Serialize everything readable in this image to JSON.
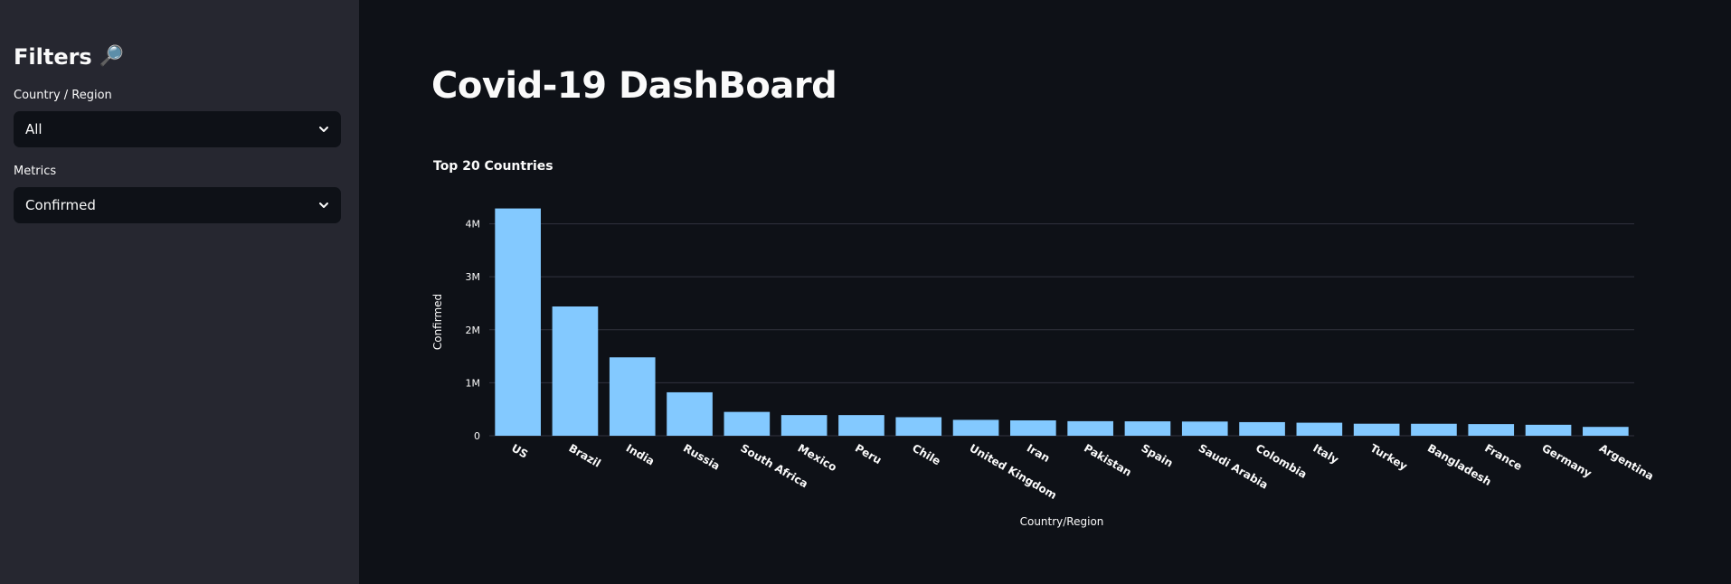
{
  "sidebar": {
    "title": "Filters",
    "title_icon": "🔎",
    "country_label": "Country / Region",
    "country_value": "All",
    "metrics_label": "Metrics",
    "metrics_value": "Confirmed"
  },
  "main": {
    "title": "Covid-19 DashBoard"
  },
  "colors": {
    "background": "#0e1117",
    "sidebar": "#262730",
    "bar": "#83c9ff",
    "grid": "#31333f"
  },
  "chart_data": {
    "type": "bar",
    "title": "Top 20 Countries",
    "xlabel": "Country/Region",
    "ylabel": "Confirmed",
    "categories": [
      "US",
      "Brazil",
      "India",
      "Russia",
      "South Africa",
      "Mexico",
      "Peru",
      "Chile",
      "United Kingdom",
      "Iran",
      "Pakistan",
      "Spain",
      "Saudi Arabia",
      "Colombia",
      "Italy",
      "Turkey",
      "Bangladesh",
      "France",
      "Germany",
      "Argentina"
    ],
    "values": [
      4290000,
      2440000,
      1480000,
      820000,
      450000,
      390000,
      390000,
      350000,
      300000,
      290000,
      275000,
      272000,
      268000,
      257000,
      246000,
      227000,
      226000,
      220000,
      207000,
      167000
    ],
    "ylim": [
      0,
      4300000
    ],
    "yticks": [
      0,
      1000000,
      2000000,
      3000000,
      4000000
    ],
    "ytick_labels": [
      "0",
      "1M",
      "2M",
      "3M",
      "4M"
    ],
    "grid": true,
    "legend": "none"
  }
}
